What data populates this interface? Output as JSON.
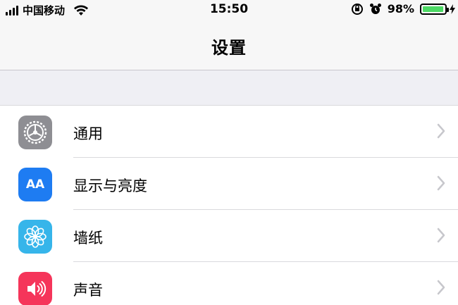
{
  "status_bar": {
    "carrier": "中国移动",
    "time": "15:50",
    "battery_percent": "98%",
    "battery_level": 0.98,
    "colors": {
      "battery_fill": "#4cd964"
    }
  },
  "nav": {
    "title": "设置"
  },
  "settings": {
    "items": [
      {
        "label": "通用",
        "icon": "gear-icon",
        "color": "#8e8e93"
      },
      {
        "label": "显示与亮度",
        "icon": "text-size-icon",
        "icon_text": "AA",
        "color": "#1e7cf2"
      },
      {
        "label": "墙纸",
        "icon": "flower-icon",
        "color": "#36b5ea"
      },
      {
        "label": "声音",
        "icon": "speaker-icon",
        "color": "#f5355a"
      }
    ]
  }
}
